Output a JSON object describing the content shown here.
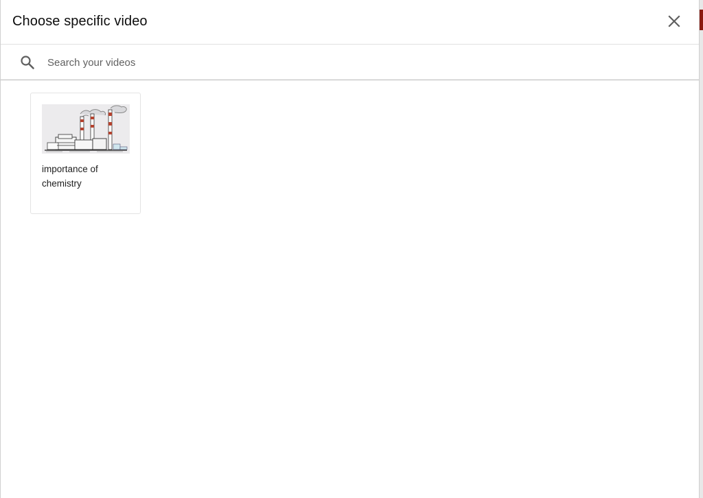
{
  "dialog": {
    "title": "Choose specific video",
    "close_icon": "close-icon"
  },
  "search": {
    "icon": "search-icon",
    "placeholder": "Search your videos",
    "value": ""
  },
  "videos": [
    {
      "title": "importance of chemistry",
      "thumbnail": "factory-smokestacks-sketch"
    }
  ],
  "colors": {
    "title_text": "#0d0d0d",
    "placeholder_text": "#606060",
    "divider": "#e0e0e0",
    "background": "#ffffff"
  }
}
